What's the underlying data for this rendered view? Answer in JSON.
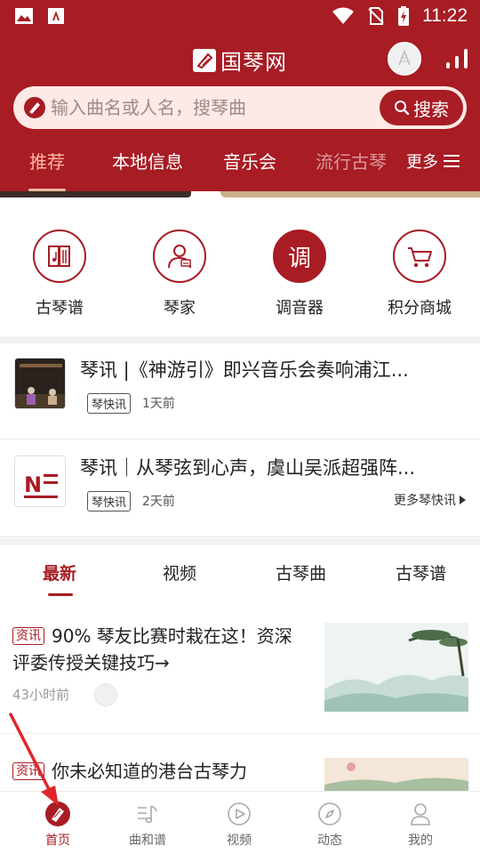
{
  "status_bar": {
    "time": "11:22"
  },
  "header": {
    "app_title": "国琴网",
    "search": {
      "placeholder": "输入曲名或人名，搜琴曲",
      "button_label": "搜索"
    },
    "nav": {
      "items": [
        "推荐",
        "本地信息",
        "音乐会"
      ],
      "truncated_item": "流行古琴",
      "more_label": "更多",
      "active_index": 0
    }
  },
  "quick_entries": [
    {
      "label": "古琴谱",
      "icon": "book-icon"
    },
    {
      "label": "琴家",
      "icon": "person-icon"
    },
    {
      "label": "调音器",
      "icon": "tuner-icon",
      "glyph": "调"
    },
    {
      "label": "积分商城",
      "icon": "cart-icon"
    }
  ],
  "news": [
    {
      "title": "琴讯 |《神游引》即兴音乐会奏响浦江...",
      "tag": "琴快讯",
      "time": "1天前"
    },
    {
      "title": "琴讯｜从琴弦到心声，虞山吴派超强阵...",
      "tag": "琴快讯",
      "time": "2天前",
      "more_label": "更多琴快讯"
    }
  ],
  "tabs": {
    "items": [
      "最新",
      "视频",
      "古琴曲",
      "古琴谱"
    ],
    "active_index": 0
  },
  "articles": [
    {
      "tag": "资讯",
      "title": "90% 琴友比赛时栽在这！资深评委传授关键技巧→",
      "time": "43小时前"
    },
    {
      "tag": "资讯",
      "title": "你未必知道的港台古琴力"
    }
  ],
  "bottom_nav": {
    "items": [
      {
        "label": "首页",
        "icon": "home-icon"
      },
      {
        "label": "曲和谱",
        "icon": "score-icon"
      },
      {
        "label": "视频",
        "icon": "video-icon"
      },
      {
        "label": "动态",
        "icon": "compass-icon"
      },
      {
        "label": "我的",
        "icon": "profile-icon"
      }
    ],
    "active_index": 0
  },
  "colors": {
    "brand_red": "#a81c24",
    "active_tab_text": "#ffb8a0",
    "search_bg": "#fde9e6"
  }
}
